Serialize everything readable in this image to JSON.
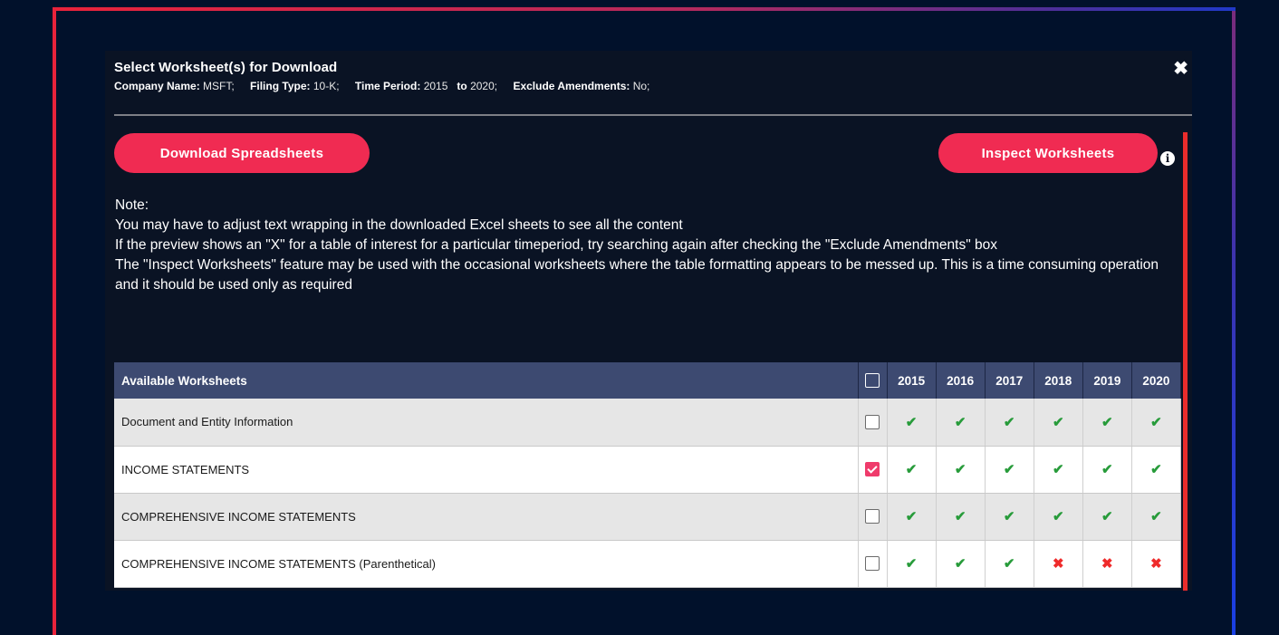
{
  "modal": {
    "title": "Select Worksheet(s) for Download",
    "close_glyph": "✖",
    "meta": {
      "company_label": "Company Name:",
      "company_value": "MSFT;",
      "filing_label": "Filing Type:",
      "filing_value": "10-K;",
      "period_label": "Time Period:",
      "period_from": "2015",
      "period_to_label": "to",
      "period_to": "2020;",
      "amend_label": "Exclude Amendments:",
      "amend_value": "No;"
    }
  },
  "buttons": {
    "download": "Download Spreadsheets",
    "inspect": "Inspect Worksheets",
    "info_glyph": "i"
  },
  "note": {
    "title": "Note:",
    "lines": [
      "You may have to adjust text wrapping in the downloaded Excel sheets to see all the content",
      "If the preview shows an \"X\" for a table of interest for a particular timeperiod, try searching again after checking the \"Exclude Amendments\" box",
      "The \"Inspect Worksheets\" feature may be used with the occasional worksheets where the table formatting appears to be messed up. This is a time consuming operation and it should be used only as required"
    ]
  },
  "table": {
    "header_label": "Available Worksheets",
    "years": [
      "2015",
      "2016",
      "2017",
      "2018",
      "2019",
      "2020"
    ],
    "tick_glyph": "✔",
    "cross_glyph": "✖",
    "rows": [
      {
        "name": "Document and Entity Information",
        "checked": false,
        "status": [
          true,
          true,
          true,
          true,
          true,
          true
        ]
      },
      {
        "name": "INCOME STATEMENTS",
        "checked": true,
        "status": [
          true,
          true,
          true,
          true,
          true,
          true
        ]
      },
      {
        "name": "COMPREHENSIVE INCOME STATEMENTS",
        "checked": false,
        "status": [
          true,
          true,
          true,
          true,
          true,
          true
        ]
      },
      {
        "name": "COMPREHENSIVE INCOME STATEMENTS (Parenthetical)",
        "checked": false,
        "status": [
          true,
          true,
          true,
          false,
          false,
          false
        ]
      }
    ]
  },
  "colors": {
    "accent": "#f02b52",
    "background": "#01112b",
    "table_header": "#3d4a71",
    "tick": "#279b3a",
    "cross": "#ef2b2b"
  }
}
